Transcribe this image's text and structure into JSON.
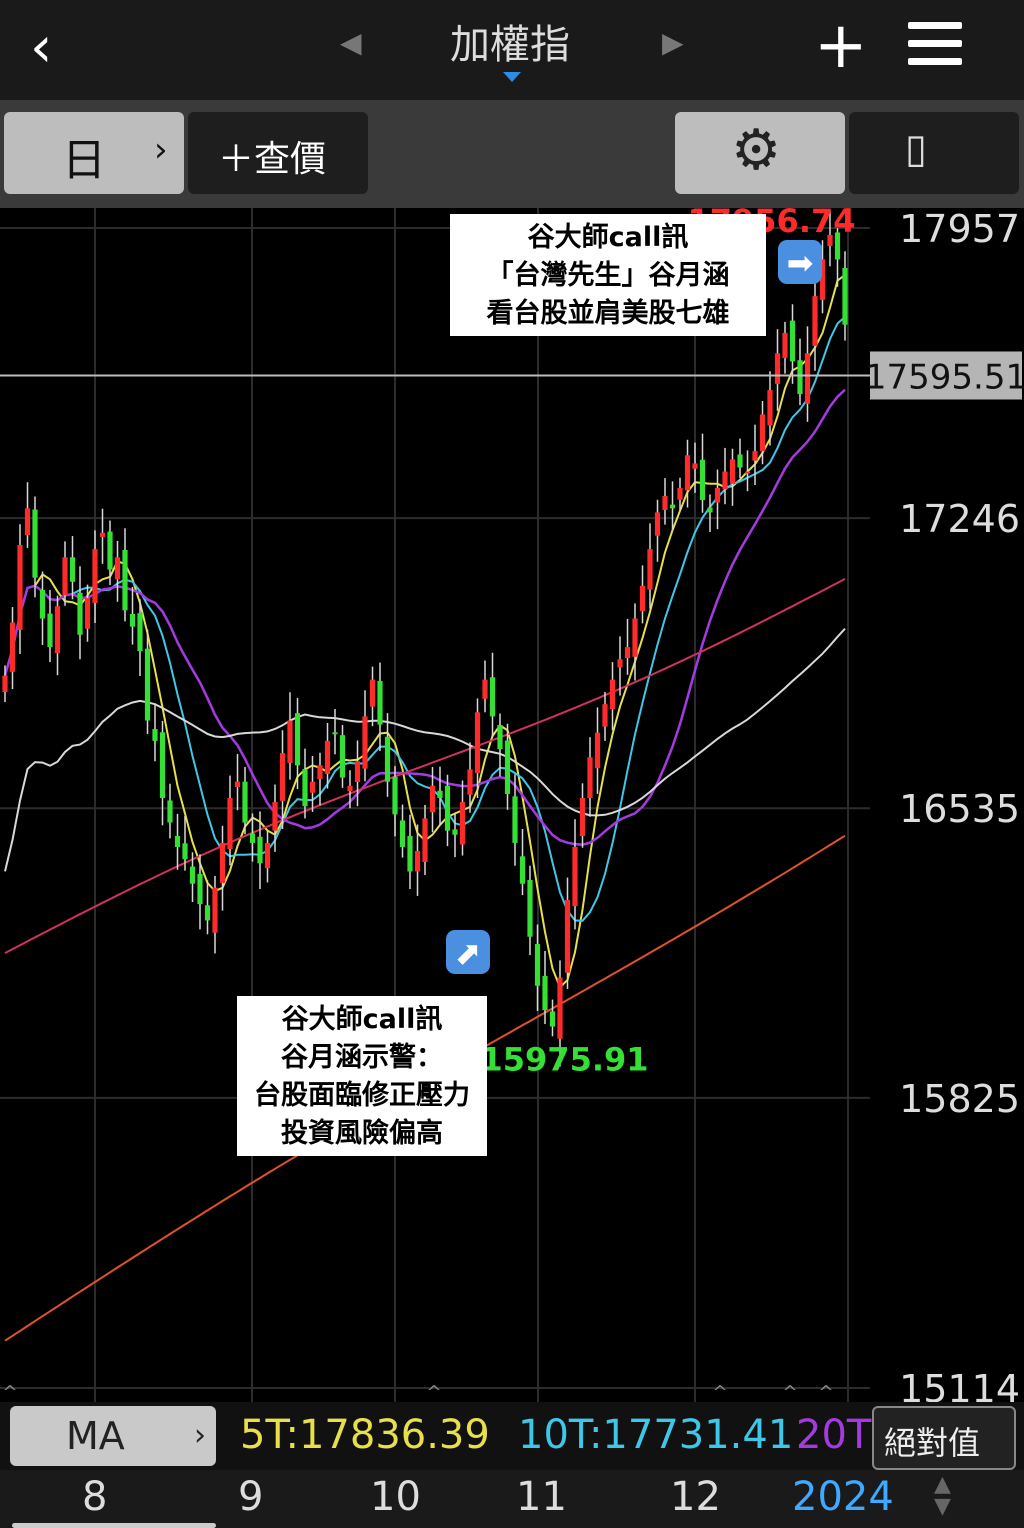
{
  "nav": {
    "title": "加權指",
    "back_icon": "‹",
    "prev_icon": "◀",
    "next_icon": "▶",
    "add_icon": "+"
  },
  "toolbar": {
    "period_label": "日",
    "period_chevron": "›",
    "quote_label": "＋查價",
    "settings_icon": "⚙",
    "rotate_icon": "▯"
  },
  "price_axis": {
    "labels": [
      "17957",
      "17246",
      "16535",
      "15825",
      "15114"
    ],
    "current_price": "17595.51"
  },
  "annotations": {
    "high_value": "17956.74",
    "low_value": "15975.91",
    "high_note": [
      "谷大師call訊",
      "「台灣先生」谷月涵",
      "看台股並肩美股七雄"
    ],
    "low_note": [
      "谷大師call訊",
      "谷月涵示警：",
      "台股面臨修正壓力",
      "投資風險偏高"
    ],
    "right_arrow_icon": "➡",
    "up_right_arrow_icon": "⬈"
  },
  "colors": {
    "up": "#ff2b2b",
    "down": "#35e035",
    "ma5": "#e8e04a",
    "ma10": "#3fc7e8",
    "ma20": "#a23be0",
    "ma60": "#d8d8d8",
    "ma120": "#d0335a",
    "ma240": "#e0522b"
  },
  "ma_bar": {
    "button_label": "MA",
    "button_chevron": "›",
    "ma5": "5T:17836.39",
    "ma10": "10T:17731.41",
    "ma20": "20T",
    "abs_label": "絕對值"
  },
  "x_axis": {
    "labels": [
      "8",
      "9",
      "10",
      "11",
      "12",
      "2024"
    ]
  },
  "chart_data": {
    "type": "candlestick",
    "y_range": [
      15114,
      17957
    ],
    "high": 17956.74,
    "low": 15975.91,
    "current": 17595.51,
    "x_categories": [
      "8",
      "9",
      "10",
      "11",
      "12",
      "2024"
    ],
    "closes": [
      16860,
      16990,
      17180,
      17270,
      17100,
      17000,
      16930,
      17030,
      17150,
      17090,
      16960,
      17050,
      17170,
      17210,
      17120,
      17150,
      17020,
      16980,
      16920,
      16750,
      16700,
      16560,
      16500,
      16440,
      16410,
      16350,
      16300,
      16260,
      16340,
      16450,
      16560,
      16600,
      16500,
      16450,
      16400,
      16450,
      16550,
      16670,
      16750,
      16640,
      16540,
      16600,
      16640,
      16700,
      16720,
      16610,
      16590,
      16650,
      16760,
      16850,
      16740,
      16600,
      16520,
      16440,
      16380,
      16430,
      16510,
      16590,
      16560,
      16480,
      16470,
      16550,
      16630,
      16770,
      16850,
      16760,
      16680,
      16570,
      16450,
      16350,
      16220,
      16100,
      16040,
      16000,
      16120,
      16310,
      16440,
      16560,
      16660,
      16720,
      16790,
      16850,
      16900,
      16930,
      17000,
      17080,
      17170,
      17260,
      17300,
      17270,
      17320,
      17400,
      17380,
      17290,
      17260,
      17320,
      17360,
      17390,
      17370,
      17360,
      17410,
      17500,
      17560,
      17650,
      17700,
      17630,
      17550,
      17650,
      17790,
      17880,
      17940,
      17880,
      17720
    ],
    "series": [
      {
        "name": "5T",
        "last": "17836.39"
      },
      {
        "name": "10T",
        "last": "17731.41"
      },
      {
        "name": "20T"
      }
    ]
  }
}
